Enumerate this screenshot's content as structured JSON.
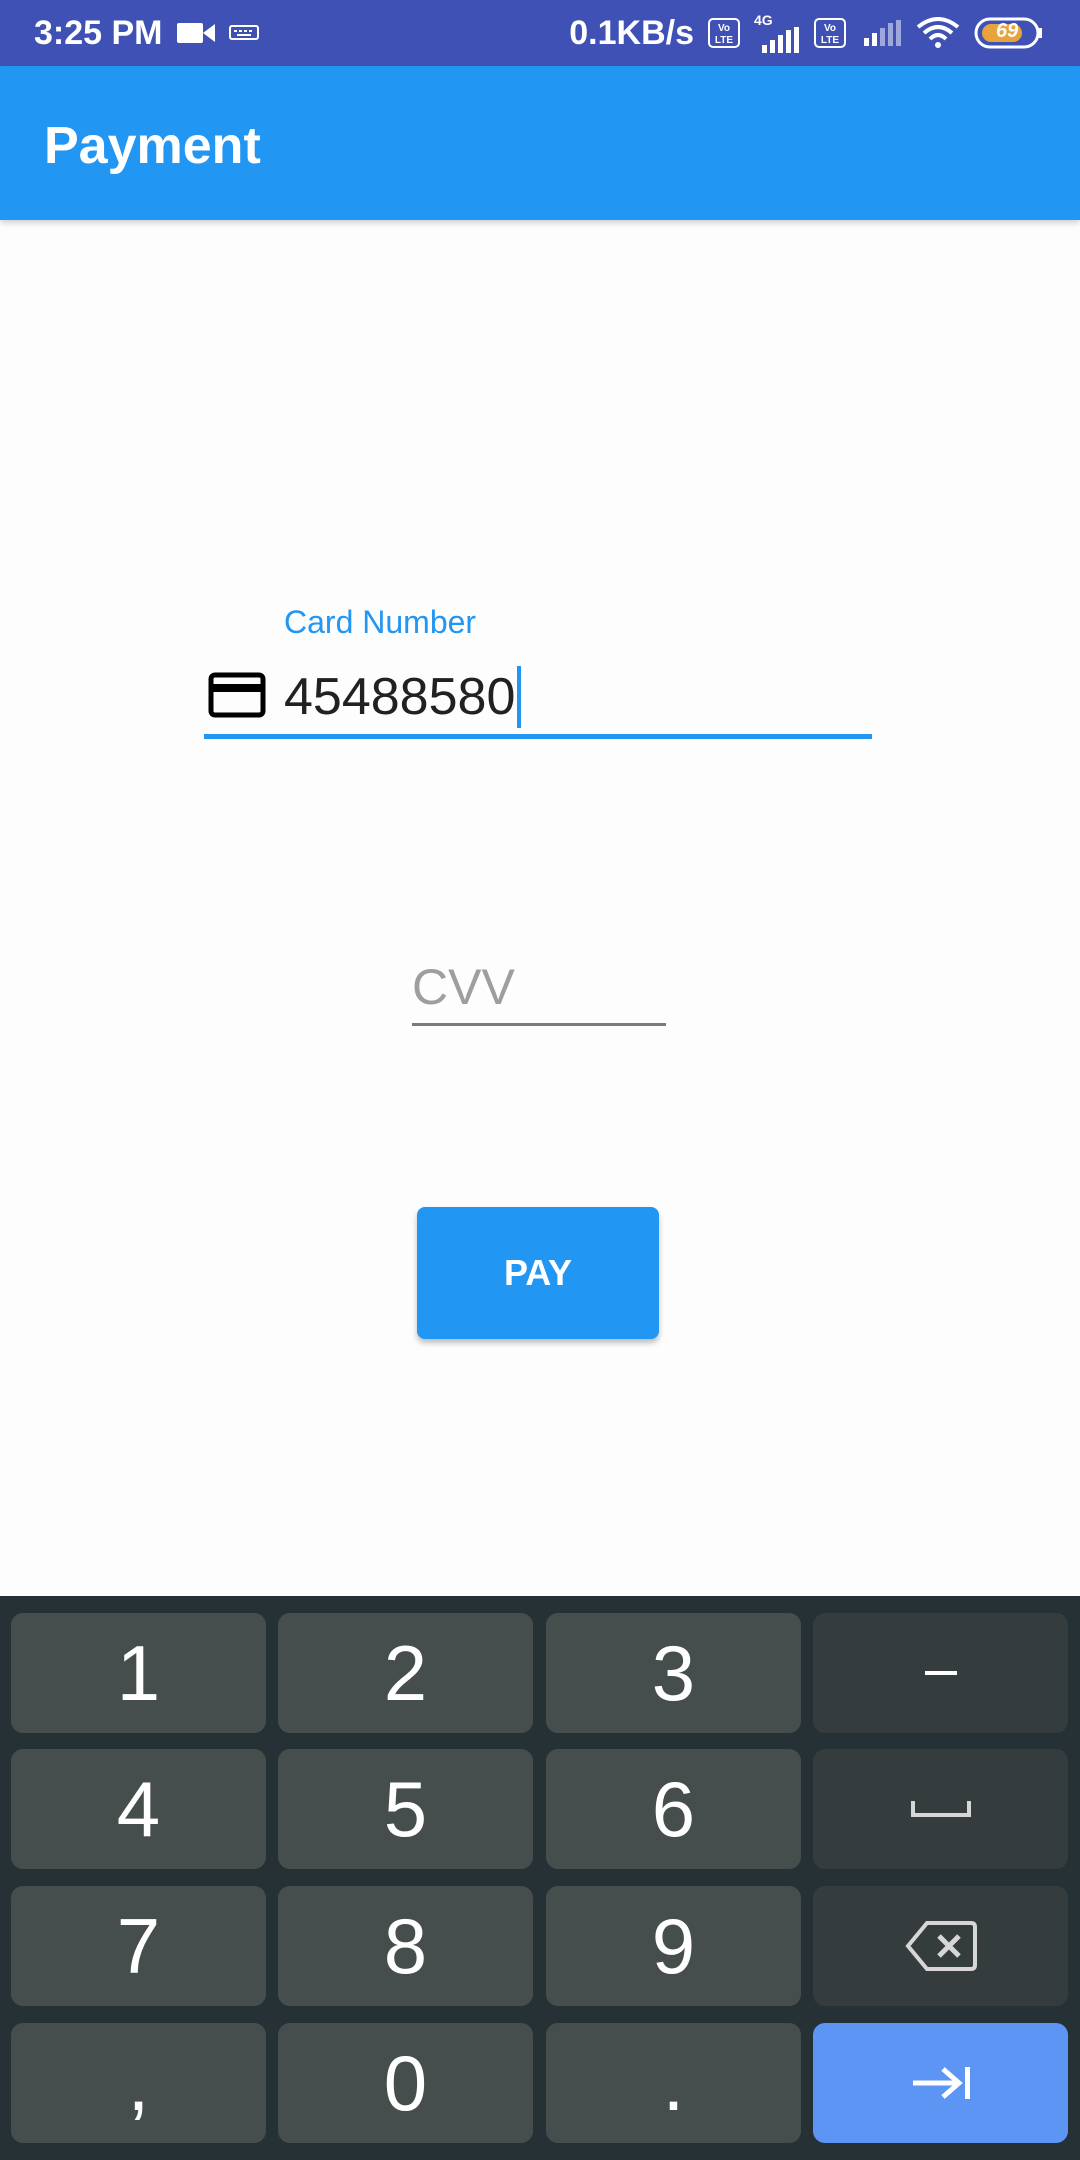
{
  "status_bar": {
    "time": "3:25 PM",
    "net_speed": "0.1KB/s",
    "network_type": "4G",
    "battery": "69",
    "icons": [
      "video-icon",
      "keyboard-icon",
      "volte-icon",
      "signal-icon",
      "wifi-icon",
      "battery-icon"
    ]
  },
  "app_bar": {
    "title": "Payment"
  },
  "form": {
    "card_label": "Card Number",
    "card_value": "45488580",
    "cvv_placeholder": "CVV",
    "pay_label": "PAY"
  },
  "keyboard": {
    "rows": [
      [
        "1",
        "2",
        "3",
        "–"
      ],
      [
        "4",
        "5",
        "6",
        "␣"
      ],
      [
        "7",
        "8",
        "9",
        "⌫"
      ],
      [
        ",",
        "0",
        ".",
        "⇥"
      ]
    ]
  },
  "colors": {
    "status_bar": "#3f51b5",
    "primary": "#2196f3",
    "keyboard_bg": "#263136",
    "key_bg": "#464e4d",
    "key_action": "#5c95f4"
  }
}
